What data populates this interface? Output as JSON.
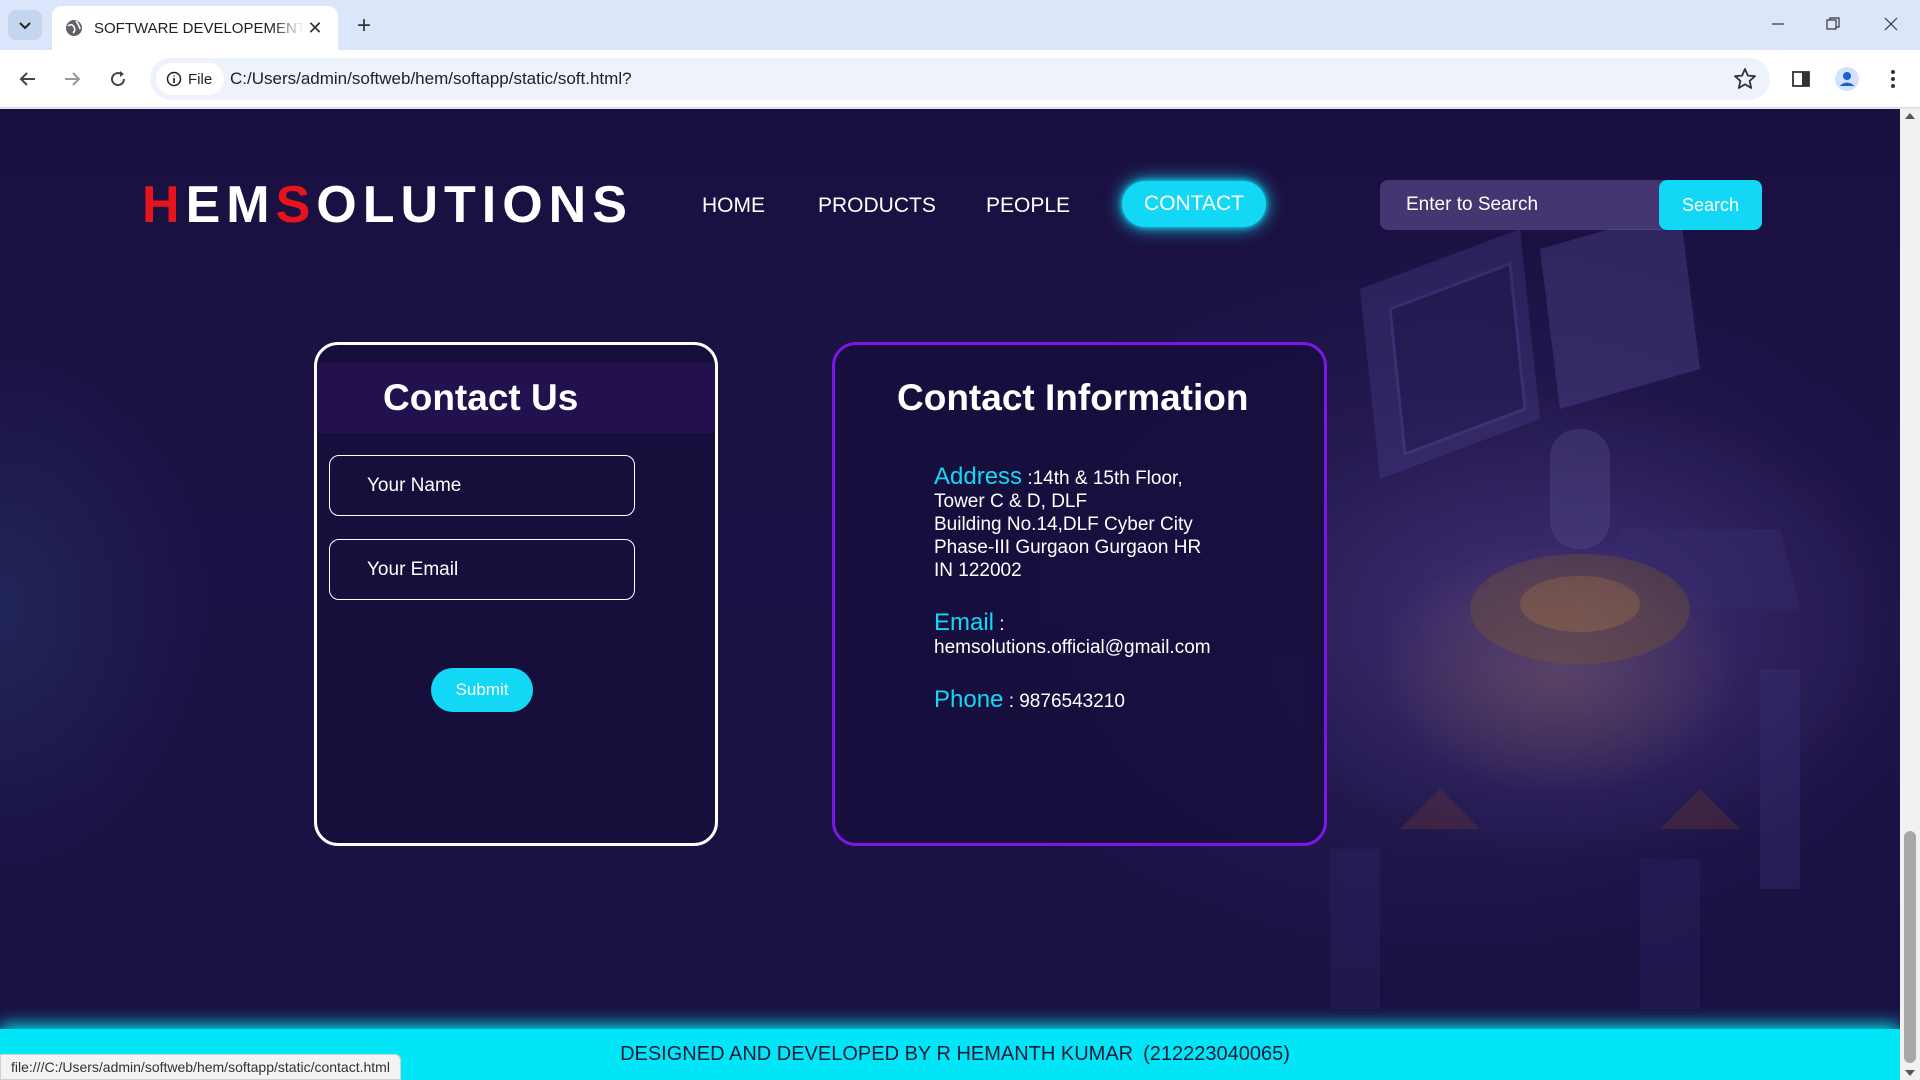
{
  "browser": {
    "tab_title": "SOFTWARE DEVELOPEMENT COMPANY",
    "site_info_label": "File",
    "url": "C:/Users/admin/softweb/hem/softapp/static/soft.html?",
    "status_url": "file:///C:/Users/admin/softweb/hem/softapp/static/contact.html"
  },
  "logo": {
    "h": "H",
    "em": "EM",
    "s": "S",
    "rest": "OLUTIONS"
  },
  "nav": {
    "home": "HOME",
    "products": "PRODUCTS",
    "people": "PEOPLE",
    "contact": "CONTACT"
  },
  "search": {
    "placeholder": "Enter to Search",
    "button": "Search"
  },
  "contact_form": {
    "title": "Contact Us",
    "name_placeholder": "Your Name",
    "email_placeholder": "Your Email",
    "submit": "Submit"
  },
  "contact_info": {
    "title": "Contact Information",
    "address_label": "Address",
    "address_lines": [
      ":14th & 15th Floor,",
      "Tower C & D, DLF",
      "Building No.14,DLF Cyber City",
      "Phase-III Gurgaon Gurgaon HR",
      "IN 122002"
    ],
    "email_label": "Email",
    "email_sep": ":",
    "email_value": "hemsolutions.official@gmail.com",
    "phone_label": "Phone",
    "phone_value": ": 9876543210"
  },
  "footer": {
    "text": "DESIGNED AND DEVELOPED BY R HEMANTH KUMAR",
    "id": "(212223040065)"
  },
  "colors": {
    "accent": "#13d8f5",
    "logo_red": "#e8141d",
    "info_border": "#7a17e6",
    "page_bg": "#1a1040"
  },
  "icons": [
    "tab-list-icon",
    "globe-icon",
    "close-icon",
    "plus-icon",
    "minimize-icon",
    "restore-icon",
    "window-close-icon",
    "back-icon",
    "forward-icon",
    "reload-icon",
    "info-icon",
    "star-icon",
    "side-panel-icon",
    "profile-icon",
    "menu-icon"
  ]
}
